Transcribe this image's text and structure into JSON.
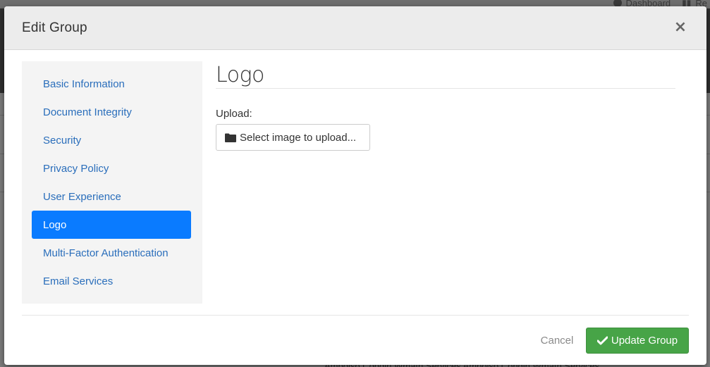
{
  "background": {
    "nav_items": [
      "Dashboard",
      "Re"
    ],
    "footer_text": "Ampoiso Condin Wmath Services   Ampoiso Condin Wmath Services"
  },
  "modal": {
    "title": "Edit Group",
    "close_label": "×"
  },
  "sidebar": {
    "items": [
      {
        "label": "Basic Information",
        "active": false
      },
      {
        "label": "Document Integrity",
        "active": false
      },
      {
        "label": "Security",
        "active": false
      },
      {
        "label": "Privacy Policy",
        "active": false
      },
      {
        "label": "User Experience",
        "active": false
      },
      {
        "label": "Logo",
        "active": true
      },
      {
        "label": "Multi-Factor Authentication",
        "active": false
      },
      {
        "label": "Email Services",
        "active": false
      }
    ]
  },
  "content": {
    "title": "Logo",
    "upload_label": "Upload:",
    "upload_button": "Select image to upload..."
  },
  "footer": {
    "cancel_label": "Cancel",
    "update_label": "Update Group"
  },
  "colors": {
    "accent": "#0a7bff",
    "link": "#2a6ebb",
    "success": "#47a447"
  },
  "icons": {
    "close": "close-icon",
    "folder": "folder-icon",
    "check": "check-icon"
  }
}
